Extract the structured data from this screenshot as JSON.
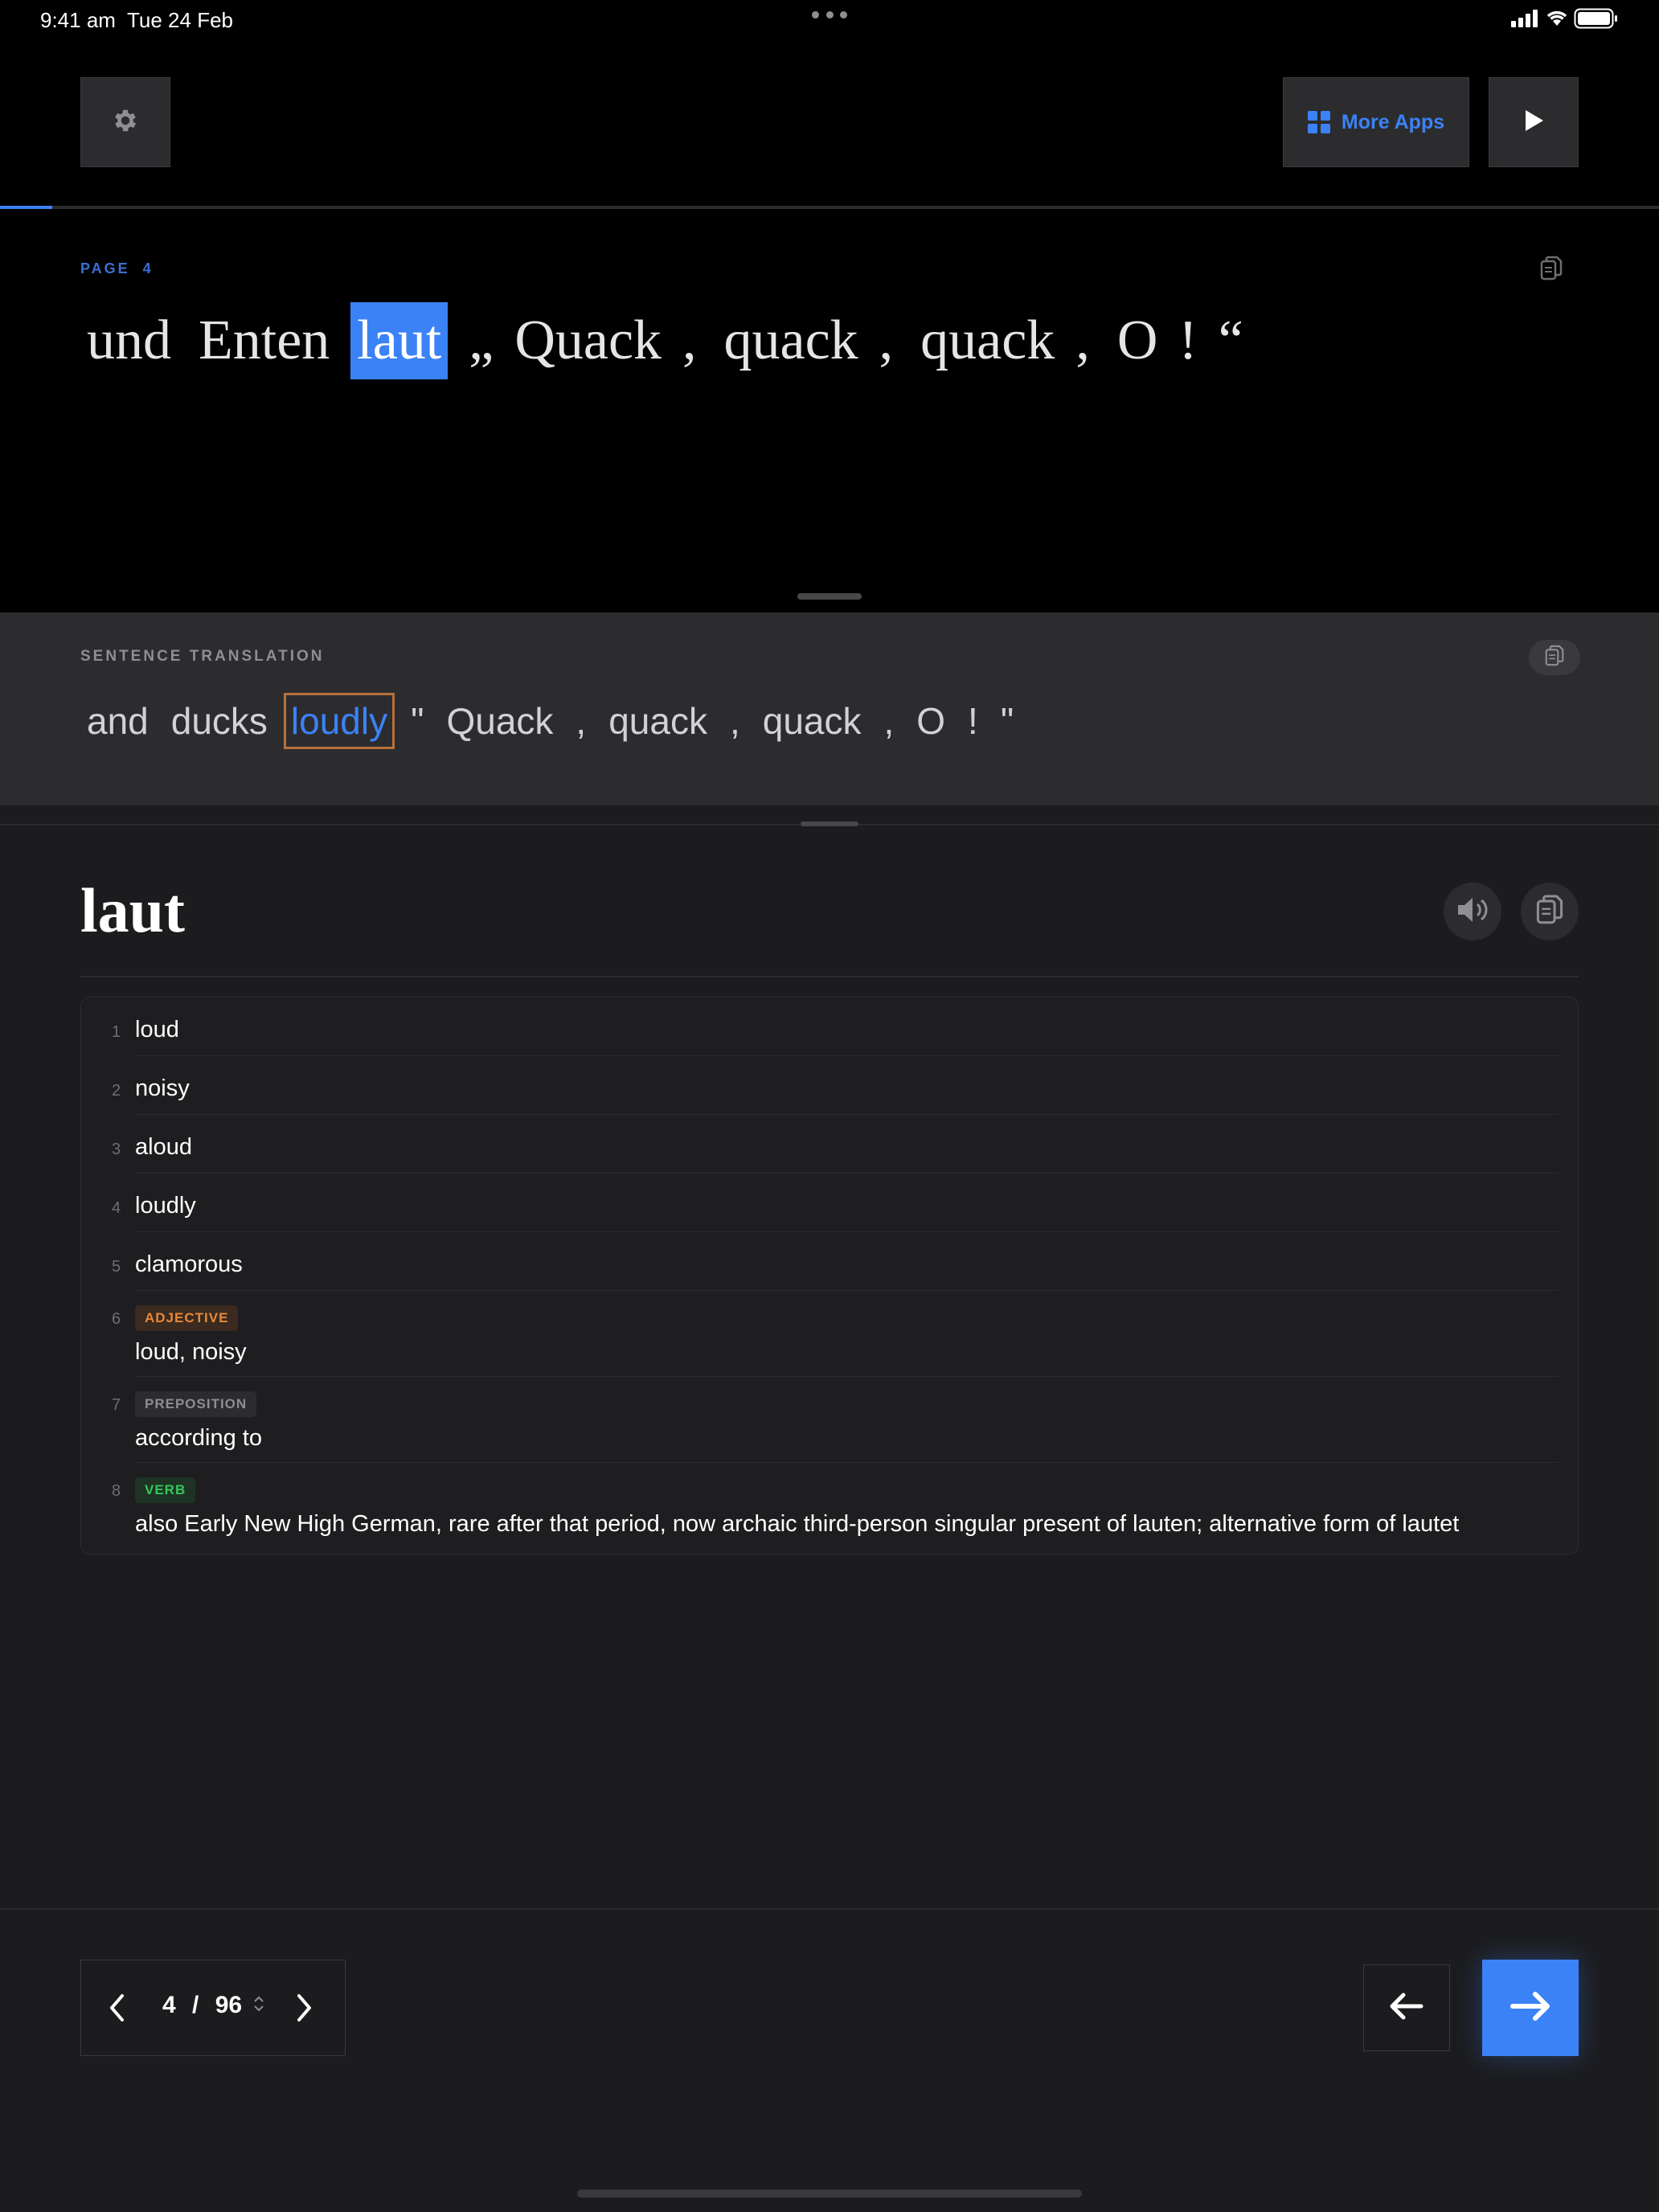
{
  "status_bar": {
    "time": "9:41 am",
    "date": "Tue 24 Feb"
  },
  "toolbar": {
    "more_apps_label": "More Apps"
  },
  "reader": {
    "page_label": "PAGE  4",
    "german_words": [
      "und",
      "Enten",
      "laut",
      "„",
      "Quack",
      ",",
      "quack",
      ",",
      "quack",
      ",",
      "O",
      "!",
      "“"
    ],
    "highlight_index": 2
  },
  "translation": {
    "label": "SENTENCE TRANSLATION",
    "english_words": [
      "and",
      "ducks",
      "loudly",
      "\"",
      "Quack",
      ",",
      "quack",
      ",",
      "quack",
      ",",
      "O",
      "!",
      "\""
    ],
    "highlight_index": 2
  },
  "word": {
    "headword": "laut",
    "definitions": [
      {
        "n": "1",
        "text": "loud"
      },
      {
        "n": "2",
        "text": "noisy"
      },
      {
        "n": "3",
        "text": "aloud"
      },
      {
        "n": "4",
        "text": "loudly"
      },
      {
        "n": "5",
        "text": "clamorous"
      },
      {
        "n": "6",
        "tag": "ADJECTIVE",
        "text": "loud, noisy"
      },
      {
        "n": "7",
        "tag": "PREPOSITION",
        "text": "according to"
      },
      {
        "n": "8",
        "tag": "VERB",
        "text": "also Early New High German, rare after that period, now archaic third-person singular present of lauten; alternative form of lautet"
      }
    ]
  },
  "pager": {
    "current": "4",
    "separator": "/",
    "total": "96",
    "progress_fraction": 0.0417
  },
  "colors": {
    "accent": "#3b82f6",
    "adjective": "#e8893a",
    "preposition": "#8e8e93",
    "verb": "#34c759"
  }
}
